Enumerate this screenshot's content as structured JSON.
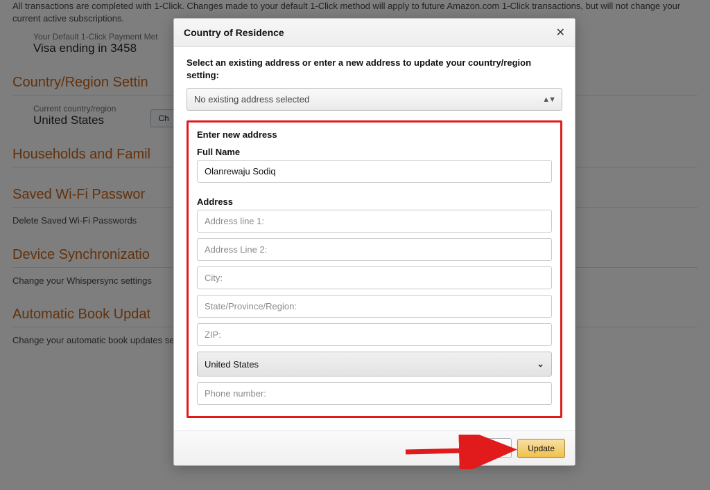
{
  "background": {
    "intro_text": "All transactions are completed with 1-Click. Changes made to your default 1-Click method will apply to future Amazon.com 1-Click transactions, but will not change your current active subscriptions.",
    "default_method_label": "Your Default 1-Click Payment Met",
    "default_method_value": "Visa ending in 3458",
    "country_section_title": "Country/Region Settin",
    "current_country_label": "Current country/region",
    "current_country_value": "United States",
    "change_button": "Ch",
    "households_title": "Households and Famil",
    "wifi_title": "Saved Wi-Fi Passwor",
    "wifi_text": "Delete Saved Wi-Fi Passwords",
    "sync_title": "Device Synchronizatio",
    "sync_text": "Change your Whispersync settings",
    "book_title": "Automatic Book Updat",
    "book_text": "Change your automatic book updates setting."
  },
  "modal": {
    "title": "Country of Residence",
    "instruction": "Select an existing address or enter a new address to update your country/region setting:",
    "address_select_label": "No existing address selected",
    "form": {
      "heading": "Enter new address",
      "full_name_label": "Full Name",
      "full_name_value": "Olanrewaju Sodiq",
      "address_label": "Address",
      "address_line1_placeholder": "Address line 1:",
      "address_line2_placeholder": "Address Line 2:",
      "city_placeholder": "City:",
      "state_placeholder": "State/Province/Region:",
      "zip_placeholder": "ZIP:",
      "country_value": "United States",
      "phone_placeholder": "Phone number:"
    },
    "footer": {
      "cancel": "",
      "update": "Update"
    }
  }
}
